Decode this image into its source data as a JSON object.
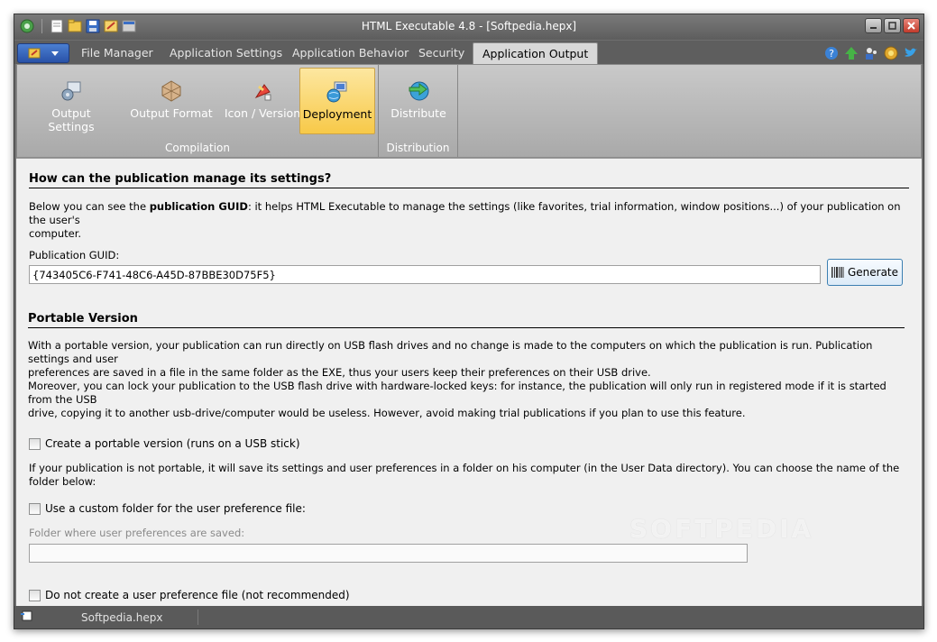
{
  "window": {
    "title": "HTML Executable 4.8 - [Softpedia.hepx]"
  },
  "tabs": [
    {
      "label": "File Manager"
    },
    {
      "label": "Application Settings"
    },
    {
      "label": "Application Behavior"
    },
    {
      "label": "Security"
    },
    {
      "label": "Application Output",
      "active": true
    }
  ],
  "ribbon": {
    "compilation_group": {
      "label": "Compilation",
      "buttons": [
        {
          "label": "Output Settings",
          "icon": "output-settings-icon"
        },
        {
          "label": "Output Format",
          "icon": "output-format-icon"
        },
        {
          "label": "Icon / Version",
          "icon": "icon-version-icon"
        },
        {
          "label": "Deployment",
          "icon": "deployment-icon",
          "selected": true
        }
      ]
    },
    "distribution_group": {
      "label": "Distribution",
      "buttons": [
        {
          "label": "Distribute",
          "icon": "distribute-icon"
        }
      ]
    }
  },
  "settings_section": {
    "heading": "How can the publication manage its settings?",
    "intro_prefix": "Below you can see the ",
    "intro_bold": "publication GUID",
    "intro_suffix": ": it helps HTML Executable to manage the settings (like favorites, trial information, window positions...) of your publication on the user's",
    "intro_line2": "computer.",
    "guid_label": "Publication GUID:",
    "guid_value": "{743405C6-F741-48C6-A45D-87BBE30D75F5}",
    "generate_label": "Generate"
  },
  "portable_section": {
    "heading": "Portable Version",
    "para_line1": "With a portable version, your publication can run directly on USB flash drives and no change is made to the computers on which the publication is run. Publication settings and user",
    "para_line2": "preferences are saved in a file in the same folder as the EXE, thus your users keep their preferences on their USB drive.",
    "para_line3": "Moreover, you can lock your publication to the USB flash drive with hardware-locked keys: for instance, the publication will only run in registered mode if it is started from the USB",
    "para_line4": "drive, copying it to another usb-drive/computer would be useless. However, avoid making trial publications if you plan to use this feature.",
    "checkbox_portable": "Create a portable version (runs on a USB stick)",
    "not_portable_text": "If your publication is not portable, it will save its settings and user preferences in a folder on his computer (in the User Data directory). You can choose the name of the folder below:",
    "checkbox_custom_folder": "Use a custom folder for the user preference file:",
    "folder_label": "Folder where user preferences are saved:",
    "folder_value": "",
    "checkbox_no_pref": "Do not create a user preference file (not recommended)"
  },
  "watermark": "SOFTPEDIA",
  "statusbar": {
    "filename": "Softpedia.hepx"
  },
  "colors": {
    "ribbon_selected": "#f7c948",
    "app_menu": "#2952a8",
    "close_button": "#c23b2b"
  }
}
